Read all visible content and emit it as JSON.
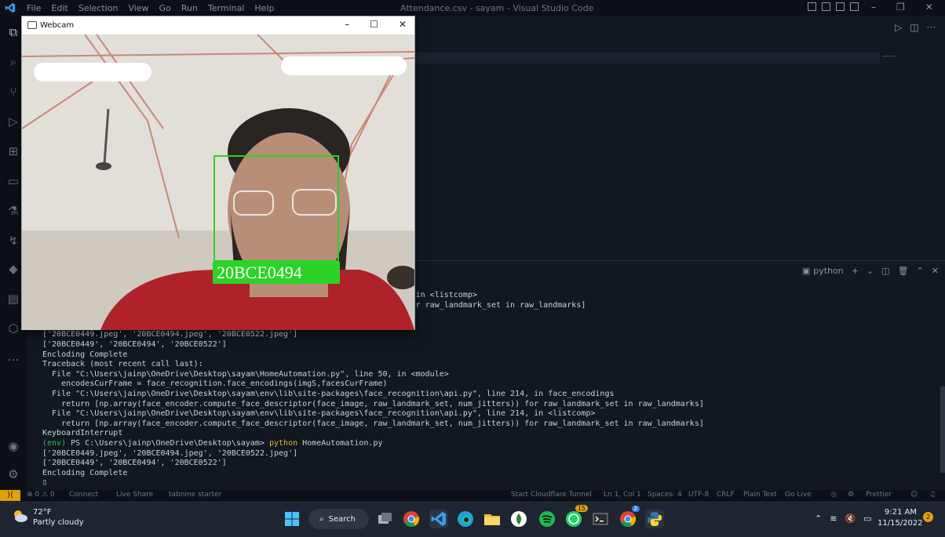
{
  "window": {
    "title": "Attendance.csv - sayam - Visual Studio Code",
    "menu": [
      "File",
      "Edit",
      "Selection",
      "View",
      "Go",
      "Run",
      "Terminal",
      "Help"
    ]
  },
  "panel": {
    "shell_label": "python"
  },
  "terminal": {
    "lines": [
      {
        "text": "                                                           _api.py\", line 214, in <listcomp>",
        "type": "plain"
      },
      {
        "text": "                                                           et, num_jitters)) for raw_landmark_set in raw_landmarks]",
        "type": "plain"
      },
      {
        "text": "",
        "type": "plain"
      },
      {
        "text": "",
        "type": "plain"
      },
      {
        "text": "['20BCE0449.jpeg', '20BCE0494.jpeg', '20BCE0522.jpeg']",
        "type": "plain"
      },
      {
        "text": "['20BCE0449', '20BCE0494', '20BCE0522']",
        "type": "plain"
      },
      {
        "text": "Encloding Complete",
        "type": "plain"
      },
      {
        "text": "Traceback (most recent call last):",
        "type": "plain"
      },
      {
        "text": "  File \"C:\\Users\\jainp\\OneDrive\\Desktop\\sayam\\HomeAutomation.py\", line 50, in <module>",
        "type": "plain"
      },
      {
        "text": "    encodesCurFrame = face_recognition.face_encodings(imgS,facesCurFrame)",
        "type": "plain"
      },
      {
        "text": "  File \"C:\\Users\\jainp\\OneDrive\\Desktop\\sayam\\env\\lib\\site-packages\\face_recognition\\api.py\", line 214, in face_encodings",
        "type": "plain"
      },
      {
        "text": "    return [np.array(face_encoder.compute_face_descriptor(face_image, raw_landmark_set, num_jitters)) for raw_landmark_set in raw_landmarks]",
        "type": "plain"
      },
      {
        "text": "  File \"C:\\Users\\jainp\\OneDrive\\Desktop\\sayam\\env\\lib\\site-packages\\face_recognition\\api.py\", line 214, in <listcomp>",
        "type": "plain"
      },
      {
        "text": "    return [np.array(face_encoder.compute_face_descriptor(face_image, raw_landmark_set, num_jitters)) for raw_landmark_set in raw_landmarks]",
        "type": "plain"
      },
      {
        "text": "KeyboardInterrupt",
        "type": "plain"
      },
      {
        "env": "(env)",
        "path": " PS C:\\Users\\jainp\\OneDrive\\Desktop\\sayam> ",
        "cmd": "python",
        "arg": " HomeAutomation.py",
        "type": "prompt"
      },
      {
        "text": "['20BCE0449.jpeg', '20BCE0494.jpeg', '20BCE0522.jpeg']",
        "type": "plain"
      },
      {
        "text": "['20BCE0449', '20BCE0494', '20BCE0522']",
        "type": "plain"
      },
      {
        "text": "Encloding Complete",
        "type": "plain"
      },
      {
        "text": "▯",
        "type": "plain"
      }
    ]
  },
  "statusbar": {
    "remote": "⟩⟨",
    "problems": "⊗ 0 ⚠ 0",
    "connect": "Connect",
    "liveshare": "Live Share",
    "tabnine": "tabnine starter",
    "cloudflare": "Start Cloudflare Tunnel",
    "position": "Ln 1, Col 1",
    "spaces": "Spaces: 4",
    "encoding": "UTF-8",
    "eol": "CRLF",
    "language": "Plain Text",
    "golive": "Go Live",
    "prettier": "Prettier"
  },
  "webcam": {
    "title": "Webcam",
    "face_label": "20BCE0494"
  },
  "taskbar": {
    "weather_temp": "72°F",
    "weather_desc": "Partly cloudy",
    "search_label": "Search",
    "whatsapp_badge": "15",
    "chrome_badge": "2",
    "time": "9:21 AM",
    "date": "11/15/2022",
    "notif_count": "2"
  },
  "colors": {
    "accent": "#e3a008",
    "face_box": "#2bd326"
  }
}
